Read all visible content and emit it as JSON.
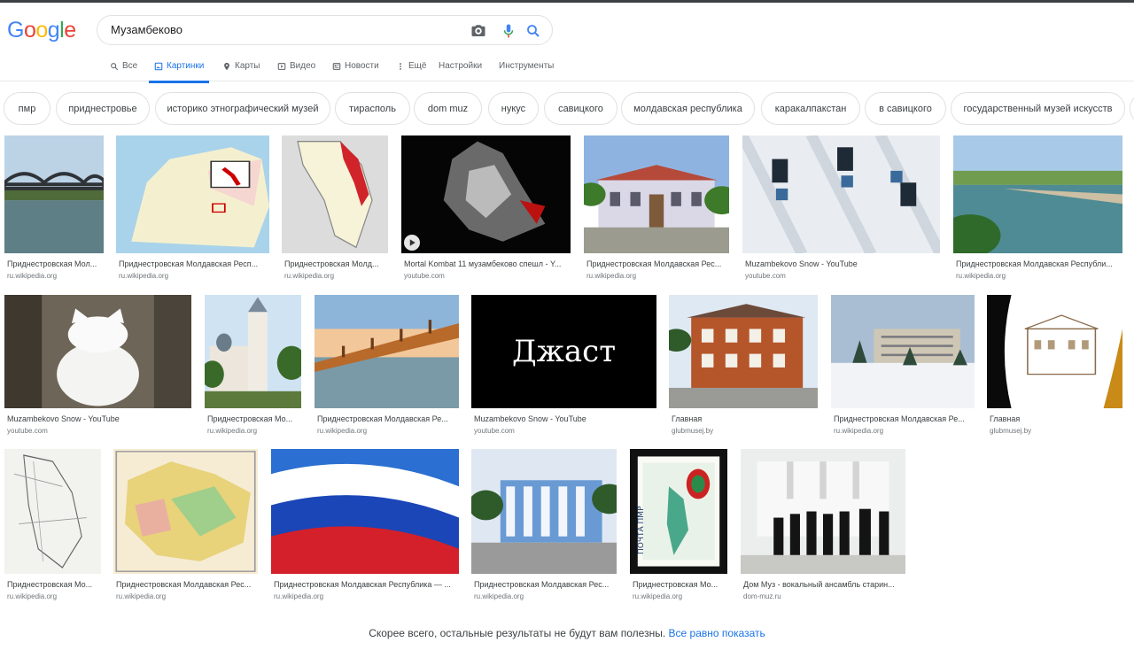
{
  "brand": {
    "logo_letters": [
      {
        "ch": "G",
        "color": "#4285f4"
      },
      {
        "ch": "o",
        "color": "#ea4335"
      },
      {
        "ch": "o",
        "color": "#fbbc05"
      },
      {
        "ch": "g",
        "color": "#4285f4"
      },
      {
        "ch": "l",
        "color": "#34a853"
      },
      {
        "ch": "e",
        "color": "#ea4335"
      }
    ]
  },
  "search": {
    "query": "Музамбеково",
    "camera_icon": "camera-icon",
    "mic_icon": "mic-icon",
    "search_icon": "search-icon"
  },
  "nav": {
    "all": "Все",
    "images": "Картинки",
    "maps": "Карты",
    "videos": "Видео",
    "news": "Новости",
    "more": "Ещё",
    "settings": "Настройки",
    "tools": "Инструменты"
  },
  "chips": [
    "пмр",
    "приднестровье",
    "историко этнографический музей",
    "тирасполь",
    "dom muz",
    "нукус",
    "савицкого",
    "молдавская республика",
    "каракалпакстан",
    "в савицкого",
    "государственный музей искусств"
  ],
  "results": [
    {
      "title": "Приднестровская Мол...",
      "source": "ru.wikipedia.org",
      "art": "bridge"
    },
    {
      "title": "Приднестровская Молдавская Респ...",
      "source": "ru.wikipedia.org",
      "art": "europe"
    },
    {
      "title": "Приднестровская Молд...",
      "source": "ru.wikipedia.org",
      "art": "moldova"
    },
    {
      "title": "Mortal Kombat 11 музамбеково спешл - Y...",
      "source": "youtube.com",
      "art": "mk"
    },
    {
      "title": "Приднестровская Молдавская Рес...",
      "source": "ru.wikipedia.org",
      "art": "building"
    },
    {
      "title": "Muzambekovo Snow - YouTube",
      "source": "youtube.com",
      "art": "snow"
    },
    {
      "title": "Приднестровская Молдавская Республи...",
      "source": "ru.wikipedia.org",
      "art": "river"
    },
    {
      "title": "Muzambekovo Snow - YouTube",
      "source": "youtube.com",
      "art": "cat"
    },
    {
      "title": "Приднестровская Мо...",
      "source": "ru.wikipedia.org",
      "art": "church"
    },
    {
      "title": "Приднестровская Молдавская Ре...",
      "source": "ru.wikipedia.org",
      "art": "bridge2"
    },
    {
      "title": "Muzambekovo Snow - YouTube",
      "source": "youtube.com",
      "art": "text",
      "text": "Джаст"
    },
    {
      "title": "Главная",
      "source": "glubmusej.by",
      "art": "brick"
    },
    {
      "title": "Приднестровская Молдавская Ре...",
      "source": "ru.wikipedia.org",
      "art": "winter"
    },
    {
      "title": "Главная",
      "source": "glubmusej.by",
      "art": "sketch"
    },
    {
      "title": "Приднестровская Мо...",
      "source": "ru.wikipedia.org",
      "art": "oldmap"
    },
    {
      "title": "Приднестровская Молдавская Рес...",
      "source": "ru.wikipedia.org",
      "art": "colormap"
    },
    {
      "title": "Приднестровская Молдавская Республика — ...",
      "source": "ru.wikipedia.org",
      "art": "flag"
    },
    {
      "title": "Приднестровская Молдавская Рес...",
      "source": "ru.wikipedia.org",
      "art": "blue"
    },
    {
      "title": "Приднестровская Мо...",
      "source": "ru.wikipedia.org",
      "art": "stamp",
      "stamp_text": "ПОЧТА ПМР"
    },
    {
      "title": "Дом Муз - вокальный ансамбль старин...",
      "source": "dom-muz.ru",
      "art": "choir"
    }
  ],
  "footer": {
    "text": "Скорее всего, остальные результаты не будут вам полезны.",
    "link": "Все равно показать"
  }
}
